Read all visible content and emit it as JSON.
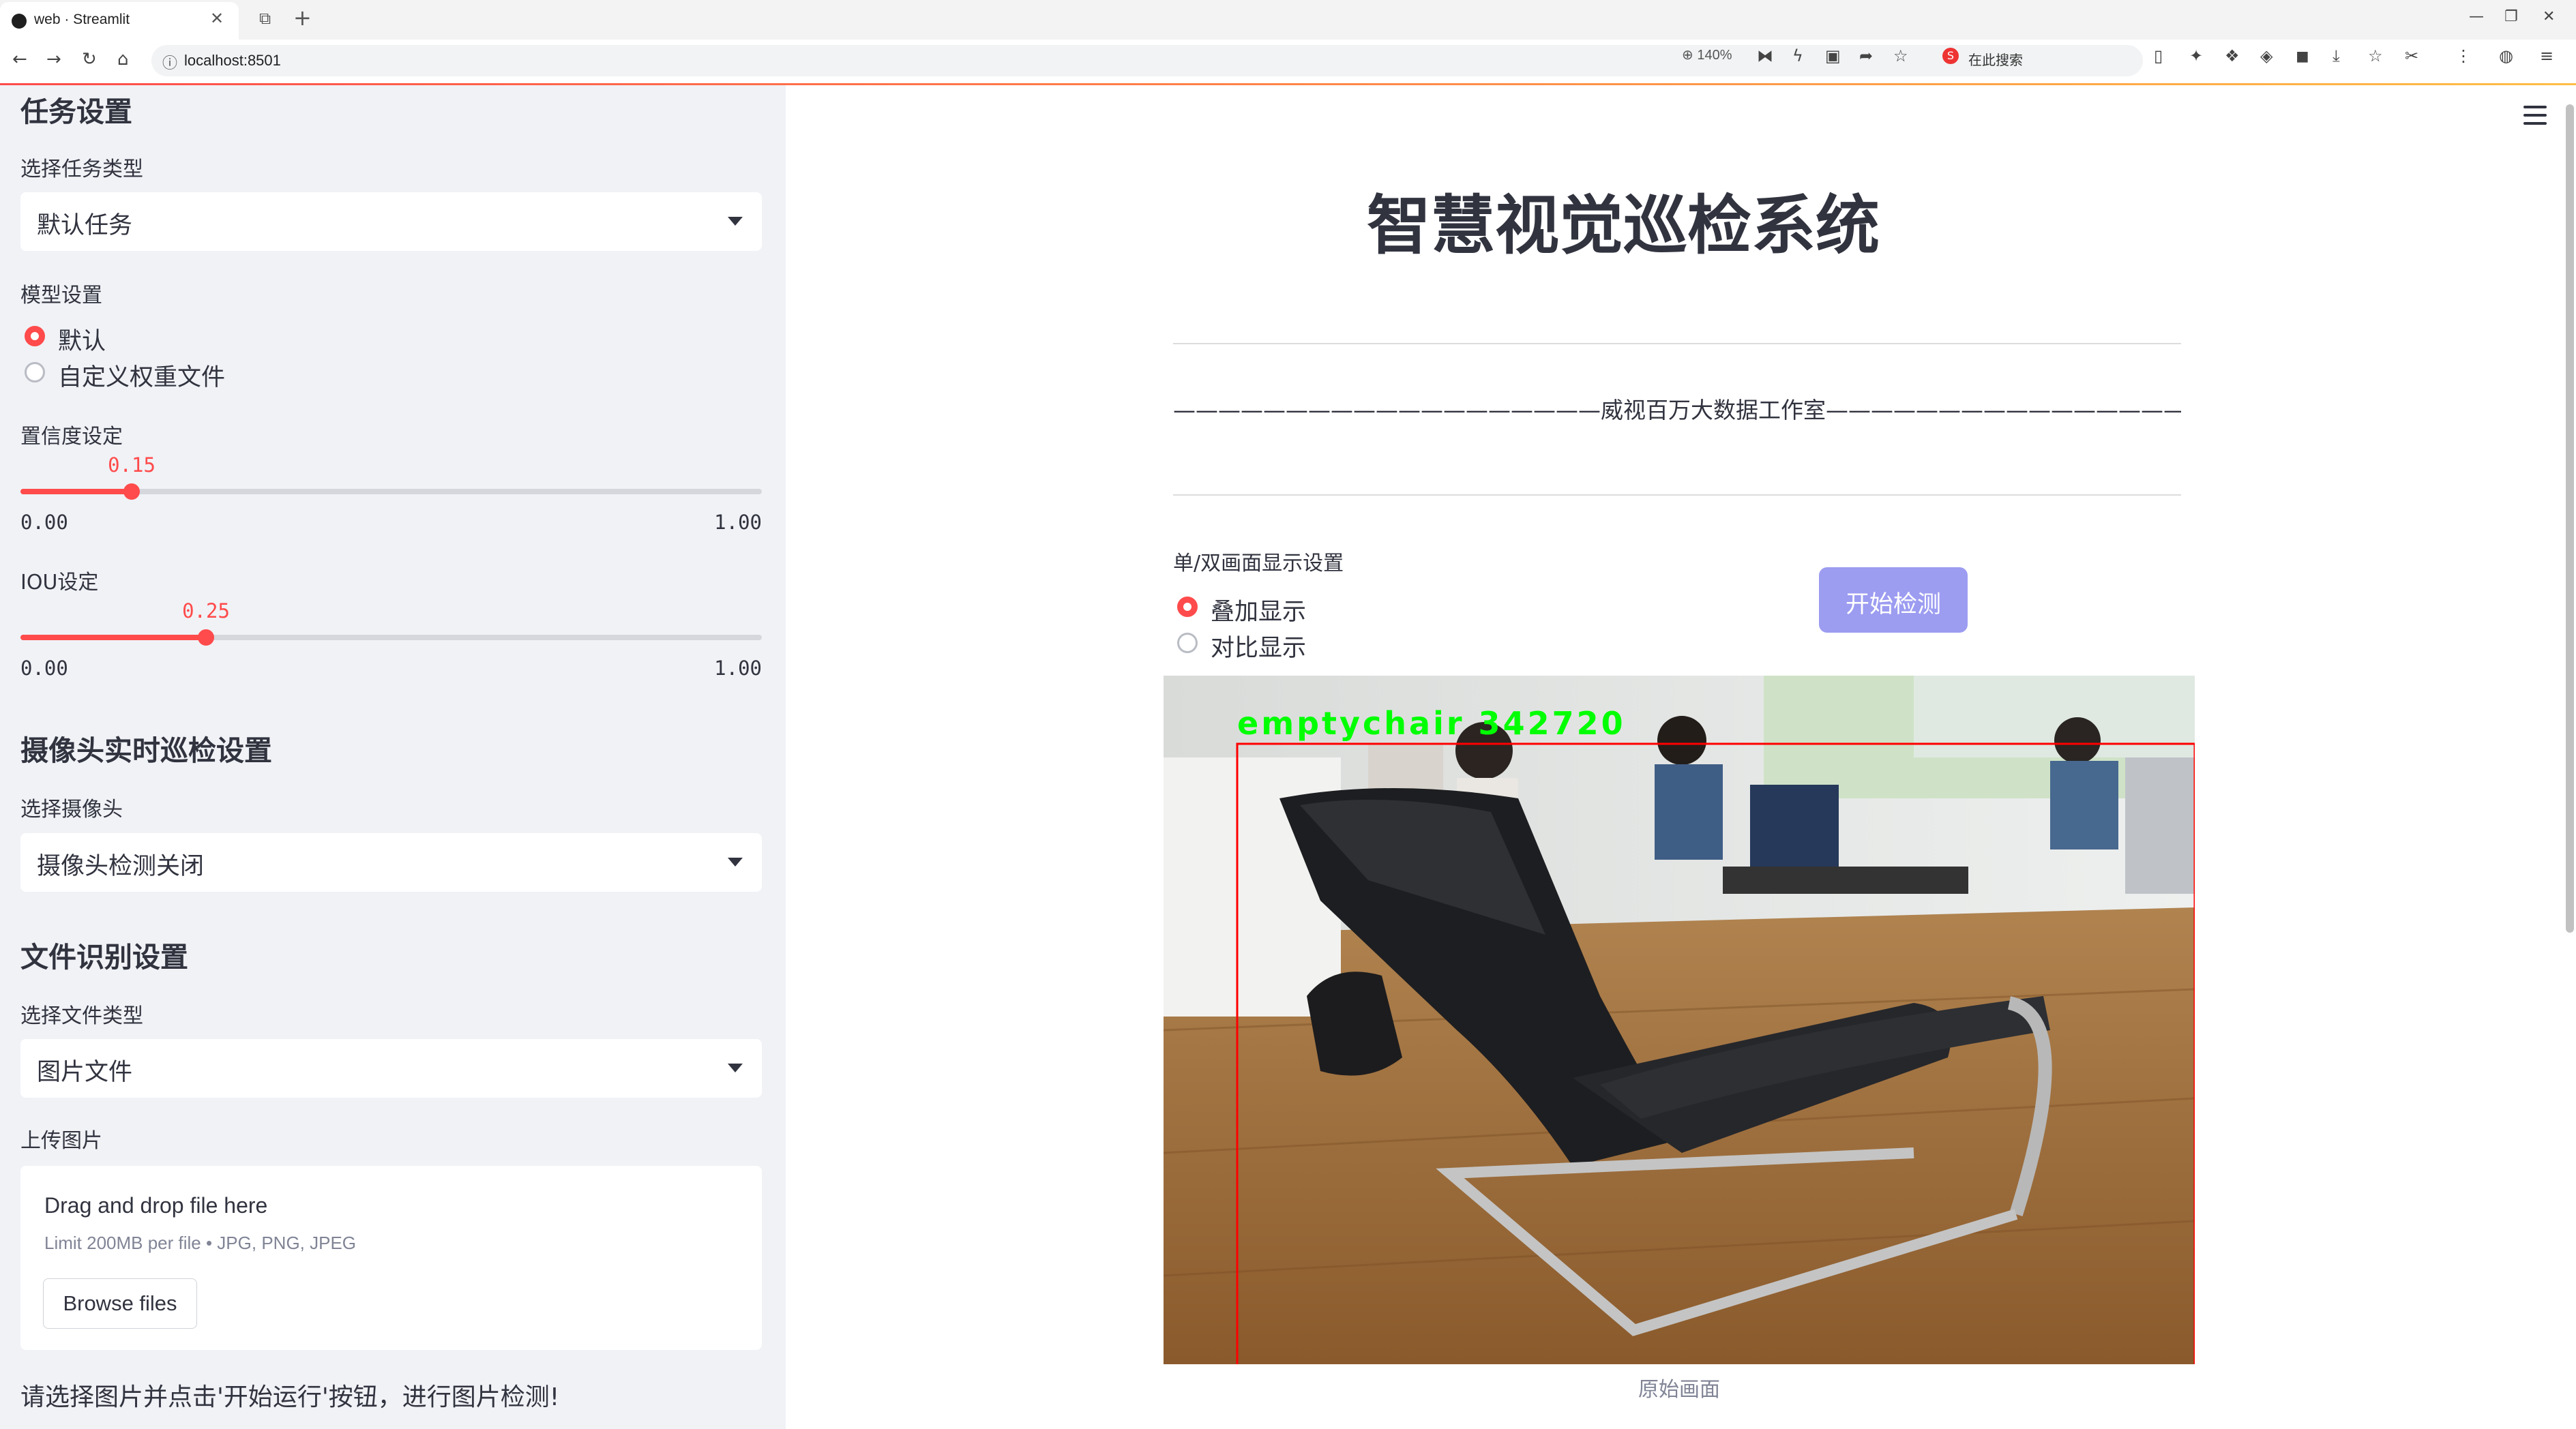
{
  "browser": {
    "tab_title": "web · Streamlit",
    "url": "localhost:8501",
    "zoom": "140%",
    "search_label": "在此搜索"
  },
  "sidebar": {
    "task_heading": "任务设置",
    "task_type_label": "选择任务类型",
    "task_type_value": "默认任务",
    "model_label": "模型设置",
    "model_options": [
      "默认",
      "自定义权重文件"
    ],
    "model_selected": "默认",
    "confidence": {
      "label": "置信度设定",
      "value": "0.15",
      "min": "0.00",
      "max": "1.00",
      "fraction": 0.15
    },
    "iou": {
      "label": "IOU设定",
      "value": "0.25",
      "min": "0.00",
      "max": "1.00",
      "fraction": 0.25
    },
    "camera_heading": "摄像头实时巡检设置",
    "camera_label": "选择摄像头",
    "camera_value": "摄像头检测关闭",
    "file_heading": "文件识别设置",
    "file_type_label": "选择文件类型",
    "file_type_value": "图片文件",
    "upload_label": "上传图片",
    "upload_drag_text": "Drag and drop file here",
    "upload_limit_text": "Limit 200MB per file • JPG, PNG, JPEG",
    "browse_button": "Browse files",
    "status_text": "请选择图片并点击'开始运行'按钮，进行图片检测!"
  },
  "main": {
    "title": "智慧视觉巡检系统",
    "studio_line": "———————————————————威视百万大数据工作室————————————————————",
    "display_label": "单/双画面显示设置",
    "display_options": [
      "叠加显示",
      "对比显示"
    ],
    "display_selected": "叠加显示",
    "start_button": "开始检测",
    "detection_label": "emptychair  342720",
    "image_caption": "原始画面"
  },
  "colors": {
    "accent": "#ff4b4b",
    "sidebar_bg": "#f0f2f6",
    "button_disabled": "#9c9cf1",
    "detection_box": "#ff0000",
    "detection_text": "#00ff00"
  }
}
